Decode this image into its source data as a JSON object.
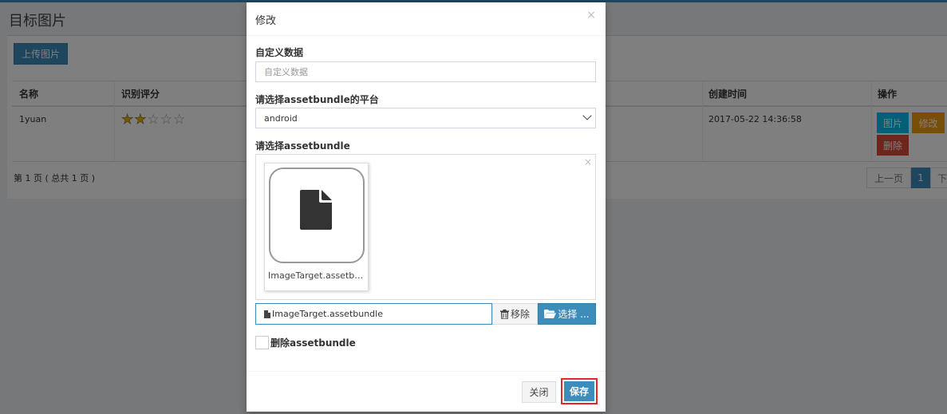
{
  "page": {
    "title": "目标图片",
    "upload_label": "上传图片"
  },
  "table": {
    "headers": {
      "name": "名称",
      "rating": "识别评分",
      "created": "创建时间",
      "actions": "操作"
    },
    "row": {
      "name": "1yuan",
      "rating_stars": 2,
      "rating_max": 5,
      "created": "2017-05-22 14:36:58",
      "btn_image": "图片",
      "btn_edit": "修改",
      "btn_delete": "删除"
    }
  },
  "pagination": {
    "info": "第 1 页 ( 总共 1 页 )",
    "prev": "上一页",
    "current": "1",
    "next": "下"
  },
  "modal": {
    "title": "修改",
    "close_icon": "×",
    "custom_data_label": "自定义数据",
    "custom_data_placeholder": "自定义数据",
    "platform_label": "请选择assetbundle的平台",
    "platform_value": "android",
    "bundle_label": "请选择assetbundle",
    "preview_close": "×",
    "preview_caption": "ImageTarget.assetbundle",
    "file_name": "ImageTarget.assetbundle",
    "remove_label": "移除",
    "choose_label": "选择 ...",
    "delete_checkbox_label": "删除assetbundle",
    "close_button": "关闭",
    "save_button": "保存"
  },
  "colors": {
    "primary": "#3c8dbc",
    "info": "#00c0ef",
    "warning": "#f39c12",
    "danger": "#dd4b39",
    "highlight": "#e8262a"
  },
  "icons": {
    "file": "file-icon",
    "trash": "trash-icon",
    "folder": "folder-open-icon",
    "file_small": "file-small-icon"
  }
}
